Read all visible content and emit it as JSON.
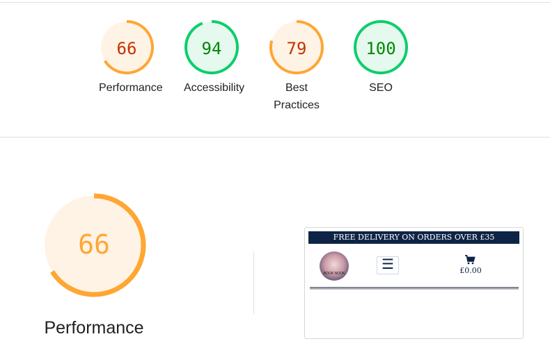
{
  "summary": {
    "gauges": [
      {
        "name": "performance",
        "score": "66",
        "value": 0.66,
        "label": "Performance",
        "status": "average"
      },
      {
        "name": "accessibility",
        "score": "94",
        "value": 0.94,
        "label": "Accessibility",
        "status": "pass"
      },
      {
        "name": "best-practices",
        "score": "79",
        "value": 0.79,
        "label": "Best Practices",
        "status": "average"
      },
      {
        "name": "seo",
        "score": "100",
        "value": 1.0,
        "label": "SEO",
        "status": "pass"
      }
    ]
  },
  "performance_section": {
    "score": "66",
    "value": 0.66,
    "label": "Performance"
  },
  "screenshot_thumbnail": {
    "banner_text": "FREE DELIVERY ON ORDERS OVER £35",
    "logo_text": "BOOK NOOK",
    "menu_icon": "hamburger-icon",
    "cart_icon": "cart-icon",
    "cart_total": "£0.00"
  },
  "colors": {
    "average_stroke": "#ffa633",
    "average_fill": "#fff3e5",
    "average_text": "#c33300",
    "average_big_text": "#ffa633",
    "pass_stroke": "#0cce6b",
    "pass_fill": "#e5f9ef",
    "pass_text": "#008800",
    "banner_bg": "#0e2446"
  }
}
